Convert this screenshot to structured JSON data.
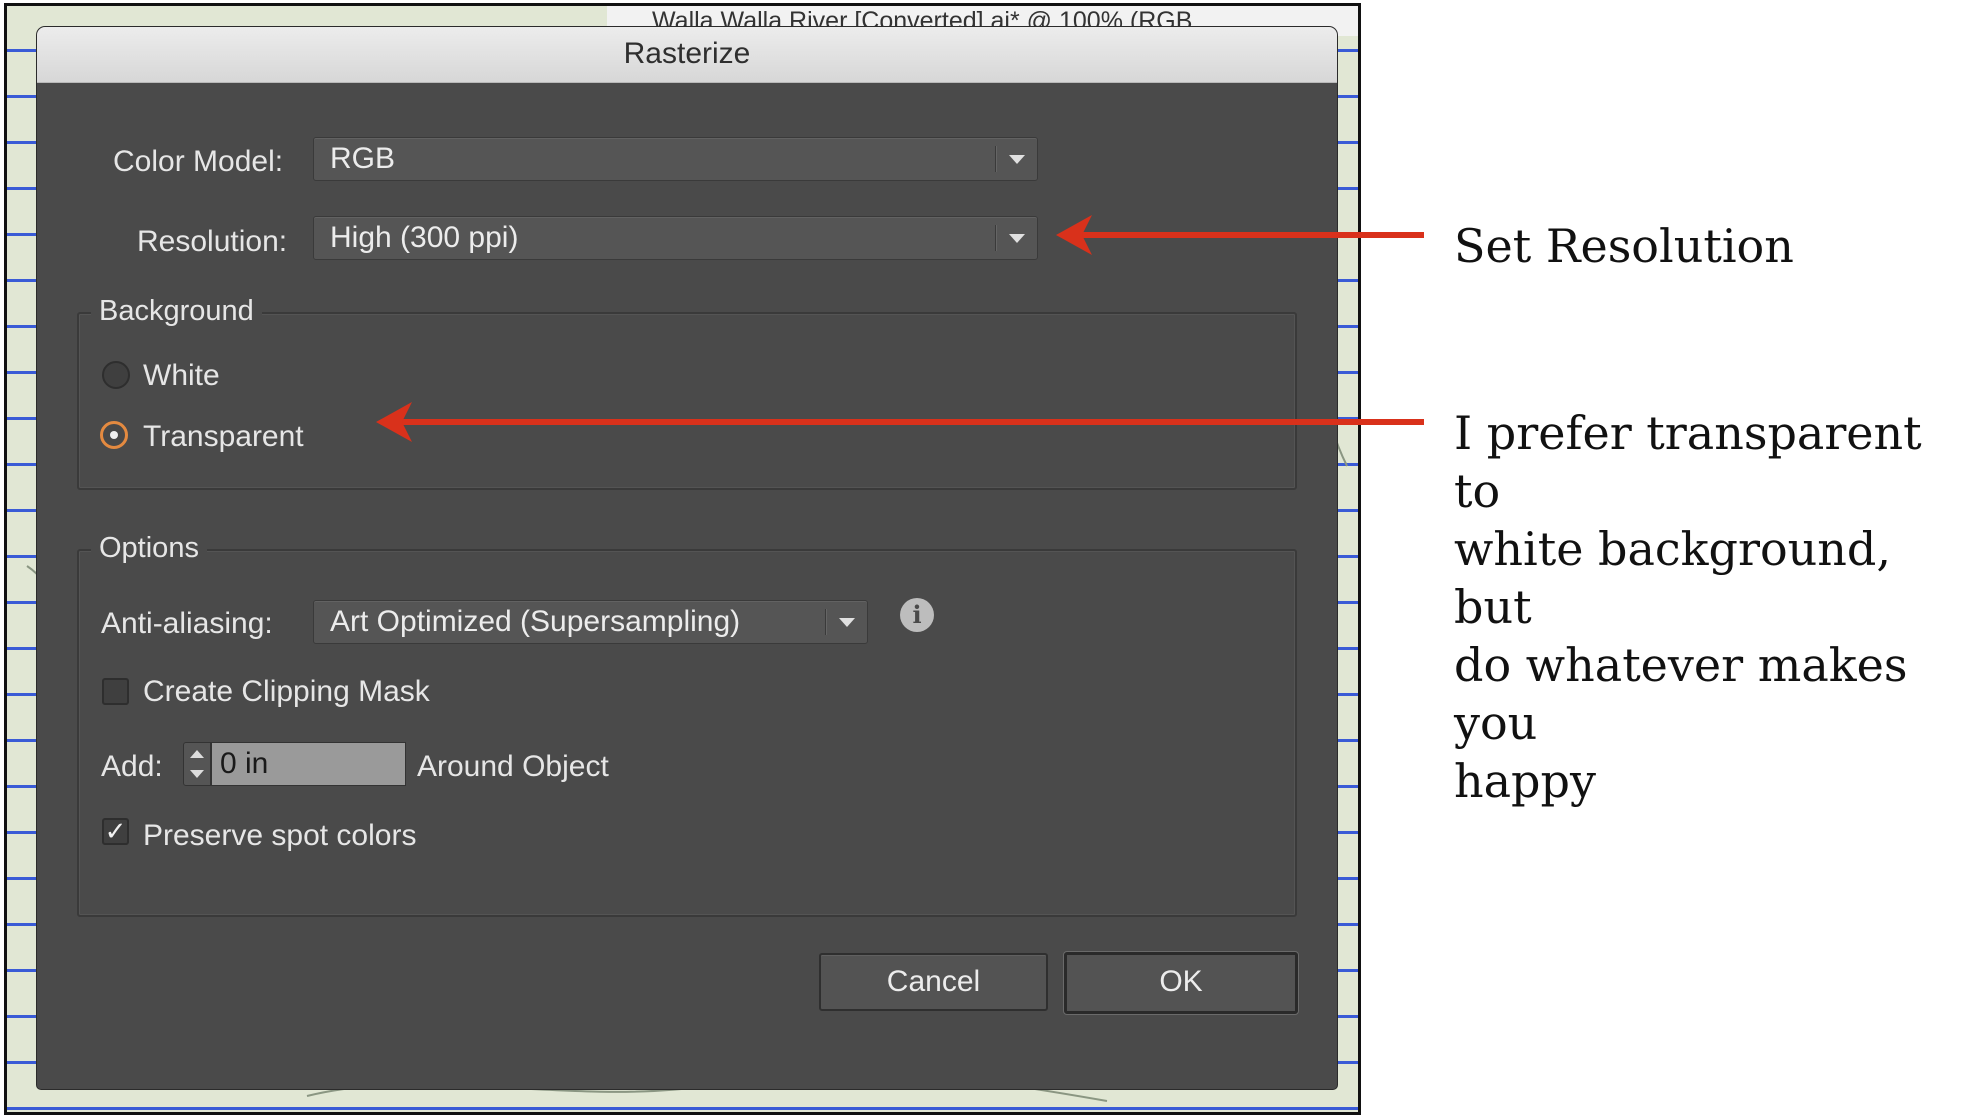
{
  "background_window": {
    "document_tab_title": "Walla Walla River [Converted].ai* @ 100% (RGB"
  },
  "dialog": {
    "title": "Rasterize",
    "color_model": {
      "label": "Color Model:",
      "value": "RGB"
    },
    "resolution": {
      "label": "Resolution:",
      "value": "High (300 ppi)"
    },
    "background": {
      "title": "Background",
      "options": [
        {
          "label": "White",
          "selected": false
        },
        {
          "label": "Transparent",
          "selected": true
        }
      ]
    },
    "options": {
      "title": "Options",
      "anti_aliasing": {
        "label": "Anti-aliasing:",
        "value": "Art Optimized (Supersampling)"
      },
      "info_icon": "info-icon",
      "create_clipping_mask": {
        "label": "Create Clipping Mask",
        "checked": false
      },
      "add": {
        "label": "Add:",
        "value": "0 in",
        "suffix": "Around Object"
      },
      "preserve_spot_colors": {
        "label": "Preserve spot colors",
        "checked": true
      }
    },
    "buttons": {
      "cancel": "Cancel",
      "ok": "OK"
    }
  },
  "annotations": {
    "resolution_note": "Set Resolution",
    "background_note_lines": [
      "I prefer transparent to",
      "white background, but",
      "do whatever makes you",
      "happy"
    ]
  },
  "colors": {
    "arrow": "#d9311b",
    "dialog_bg": "#4a4a4a",
    "radio_accent": "#e48a40",
    "grid_line": "#3a5bd6"
  }
}
